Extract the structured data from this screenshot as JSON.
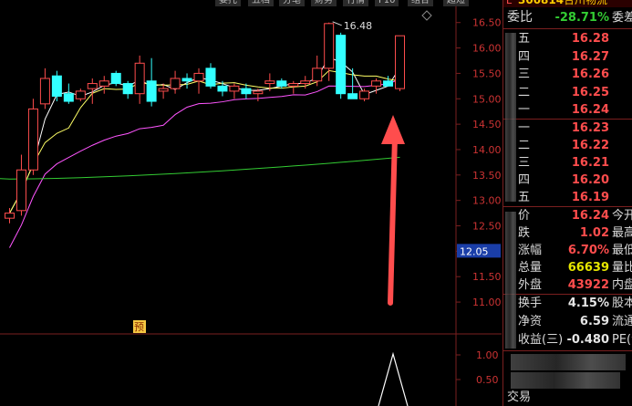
{
  "header": {
    "tabs": [
      "委托",
      "五档",
      "分笔",
      "财务",
      "行情",
      "F10",
      "组合",
      "超短"
    ],
    "stock_code": "300814",
    "stock_name": "合川物流",
    "code_prefix": "L"
  },
  "chart": {
    "price_ticks": [
      "16.50",
      "16.00",
      "15.50",
      "15.00",
      "14.50",
      "14.00",
      "13.50",
      "13.00",
      "12.50",
      "12.00",
      "11.50",
      "11.00"
    ],
    "current_price_marker": "12.05",
    "high_label": "16.48",
    "forecast_badge": "预",
    "indicator_ticks": [
      "1.00",
      "0.50"
    ],
    "ma_colors": {
      "ma5": "#ffffff",
      "ma10": "#ffff66",
      "ma20": "#ff55ff",
      "ma60": "#33cc33"
    },
    "arrow_color": "#ff4d4d"
  },
  "chart_data": {
    "type": "candlestick",
    "candles": [
      {
        "o": 12.65,
        "h": 12.85,
        "l": 12.55,
        "c": 12.75
      },
      {
        "o": 12.8,
        "h": 13.9,
        "l": 12.7,
        "c": 13.6
      },
      {
        "o": 13.6,
        "h": 15.0,
        "l": 13.5,
        "c": 14.8
      },
      {
        "o": 14.9,
        "h": 15.6,
        "l": 14.8,
        "c": 15.4
      },
      {
        "o": 15.45,
        "h": 15.55,
        "l": 14.95,
        "c": 15.05
      },
      {
        "o": 15.1,
        "h": 15.3,
        "l": 14.9,
        "c": 14.95
      },
      {
        "o": 15.0,
        "h": 15.2,
        "l": 14.95,
        "c": 15.15
      },
      {
        "o": 15.2,
        "h": 15.4,
        "l": 14.9,
        "c": 15.3
      },
      {
        "o": 15.25,
        "h": 15.45,
        "l": 15.1,
        "c": 15.35
      },
      {
        "o": 15.5,
        "h": 15.55,
        "l": 15.25,
        "c": 15.3
      },
      {
        "o": 15.3,
        "h": 15.35,
        "l": 15.0,
        "c": 15.1
      },
      {
        "o": 15.1,
        "h": 15.85,
        "l": 14.9,
        "c": 15.7
      },
      {
        "o": 15.35,
        "h": 15.8,
        "l": 14.85,
        "c": 14.95
      },
      {
        "o": 15.15,
        "h": 15.3,
        "l": 15.0,
        "c": 15.2
      },
      {
        "o": 15.2,
        "h": 15.55,
        "l": 15.1,
        "c": 15.4
      },
      {
        "o": 15.4,
        "h": 15.5,
        "l": 15.2,
        "c": 15.35
      },
      {
        "o": 15.35,
        "h": 15.6,
        "l": 15.1,
        "c": 15.5
      },
      {
        "o": 15.6,
        "h": 15.7,
        "l": 15.2,
        "c": 15.25
      },
      {
        "o": 15.25,
        "h": 15.35,
        "l": 15.05,
        "c": 15.15
      },
      {
        "o": 15.15,
        "h": 15.3,
        "l": 15.0,
        "c": 15.25
      },
      {
        "o": 15.2,
        "h": 15.3,
        "l": 15.0,
        "c": 15.1
      },
      {
        "o": 15.1,
        "h": 15.2,
        "l": 14.95,
        "c": 15.15
      },
      {
        "o": 15.3,
        "h": 15.5,
        "l": 15.15,
        "c": 15.35
      },
      {
        "o": 15.35,
        "h": 15.4,
        "l": 15.2,
        "c": 15.25
      },
      {
        "o": 15.25,
        "h": 15.35,
        "l": 15.1,
        "c": 15.3
      },
      {
        "o": 15.3,
        "h": 15.45,
        "l": 15.2,
        "c": 15.35
      },
      {
        "o": 15.35,
        "h": 15.85,
        "l": 15.25,
        "c": 15.6
      },
      {
        "o": 15.6,
        "h": 16.5,
        "l": 15.35,
        "c": 16.48
      },
      {
        "o": 16.25,
        "h": 16.3,
        "l": 15.0,
        "c": 15.1
      },
      {
        "o": 15.1,
        "h": 15.6,
        "l": 15.0,
        "c": 15.0
      },
      {
        "o": 15.0,
        "h": 15.2,
        "l": 14.95,
        "c": 15.15
      },
      {
        "o": 15.25,
        "h": 15.4,
        "l": 15.1,
        "c": 15.35
      },
      {
        "o": 15.35,
        "h": 15.45,
        "l": 15.25,
        "c": 15.25
      },
      {
        "o": 15.2,
        "h": 16.24,
        "l": 15.15,
        "c": 16.24
      }
    ],
    "ylim": [
      10.75,
      16.8
    ]
  },
  "quote": {
    "commission_label": "委比",
    "commission_value": "-28.71%",
    "commission_ext": "委差",
    "asks": [
      {
        "label": "五",
        "price": "16.28"
      },
      {
        "label": "四",
        "price": "16.27"
      },
      {
        "label": "三",
        "price": "16.26"
      },
      {
        "label": "二",
        "price": "16.25"
      },
      {
        "label": "一",
        "price": "16.24"
      }
    ],
    "bids": [
      {
        "label": "一",
        "price": "16.23"
      },
      {
        "label": "二",
        "price": "16.22"
      },
      {
        "label": "三",
        "price": "16.21"
      },
      {
        "label": "四",
        "price": "16.20"
      },
      {
        "label": "五",
        "price": "16.19"
      }
    ],
    "stats": [
      {
        "label": "价",
        "value": "16.24",
        "ext": "今开",
        "color": "#ff4d4d"
      },
      {
        "label": "跌",
        "value": "1.02",
        "ext": "最高",
        "color": "#ff4d4d"
      },
      {
        "label": "涨幅",
        "value": "6.70%",
        "ext": "最低",
        "color": "#ff4d4d"
      },
      {
        "label": "总量",
        "value": "66639",
        "ext": "量比",
        "color": "#e6e600"
      },
      {
        "label": "外盘",
        "value": "43922",
        "ext": "内盘",
        "color": "#ff4d4d"
      }
    ],
    "fundamentals": [
      {
        "label": "换手",
        "value": "4.15%",
        "ext": "股本"
      },
      {
        "label": "净资",
        "value": "6.59",
        "ext": "流通"
      },
      {
        "label": "收益(三)",
        "value": "-0.480",
        "ext": "PE(动)"
      }
    ],
    "footer_label": "交易"
  }
}
